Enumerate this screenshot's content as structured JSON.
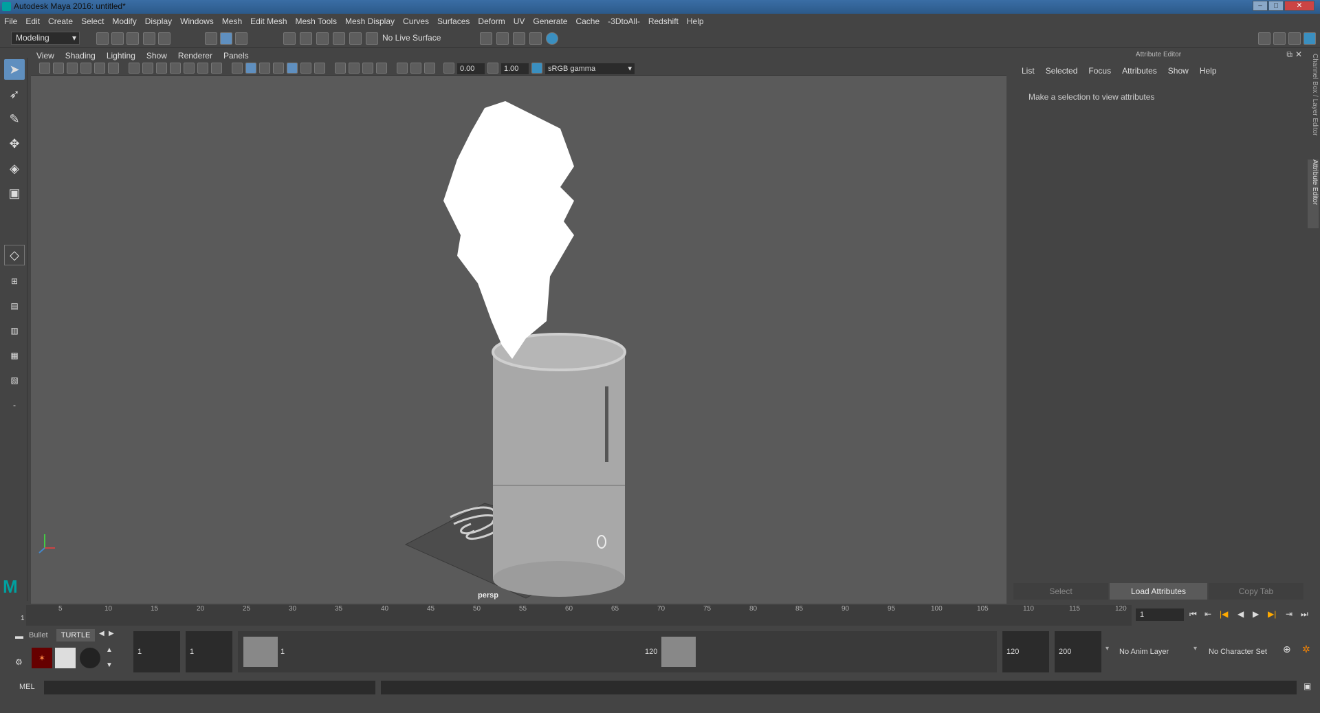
{
  "window": {
    "title": "Autodesk Maya 2016: untitled*"
  },
  "menubar": [
    "File",
    "Edit",
    "Create",
    "Select",
    "Modify",
    "Display",
    "Windows",
    "Mesh",
    "Edit Mesh",
    "Mesh Tools",
    "Mesh Display",
    "Curves",
    "Surfaces",
    "Deform",
    "UV",
    "Generate",
    "Cache",
    "-3DtoAll-",
    "Redshift",
    "Help"
  ],
  "shelf": {
    "mode": "Modeling",
    "live_surface": "No Live Surface"
  },
  "viewport": {
    "menu": [
      "View",
      "Shading",
      "Lighting",
      "Show",
      "Renderer",
      "Panels"
    ],
    "exposure": "0.00",
    "gamma": "1.00",
    "color_space": "sRGB gamma",
    "camera": "persp"
  },
  "attribute_editor": {
    "title": "Attribute Editor",
    "menu": [
      "List",
      "Selected",
      "Focus",
      "Attributes",
      "Show",
      "Help"
    ],
    "message": "Make a selection to view attributes",
    "buttons": {
      "select": "Select",
      "load": "Load Attributes",
      "copy": "Copy Tab"
    },
    "side_tabs": {
      "channel": "Channel Box / Layer Editor",
      "attr": "Attribute Editor"
    }
  },
  "timeline": {
    "ticks": [
      "5",
      "10",
      "15",
      "20",
      "25",
      "30",
      "35",
      "40",
      "45",
      "50",
      "55",
      "60",
      "65",
      "70",
      "75",
      "80",
      "85",
      "90",
      "95",
      "100",
      "105",
      "110",
      "115",
      "120"
    ],
    "start_label": "1",
    "current_frame": "1"
  },
  "range": {
    "shelf_tabs": [
      "Bullet",
      "TURTLE"
    ],
    "start": "1",
    "playback_start": "1",
    "slider_start": "1",
    "slider_end": "120",
    "playback_end": "120",
    "end": "200",
    "anim_layer": "No Anim Layer",
    "char_set": "No Character Set"
  },
  "cmdline": {
    "label": "MEL"
  },
  "colors": {
    "accent": "#5f8fbf",
    "bg": "#444444",
    "viewport": "#5a5a5a"
  }
}
